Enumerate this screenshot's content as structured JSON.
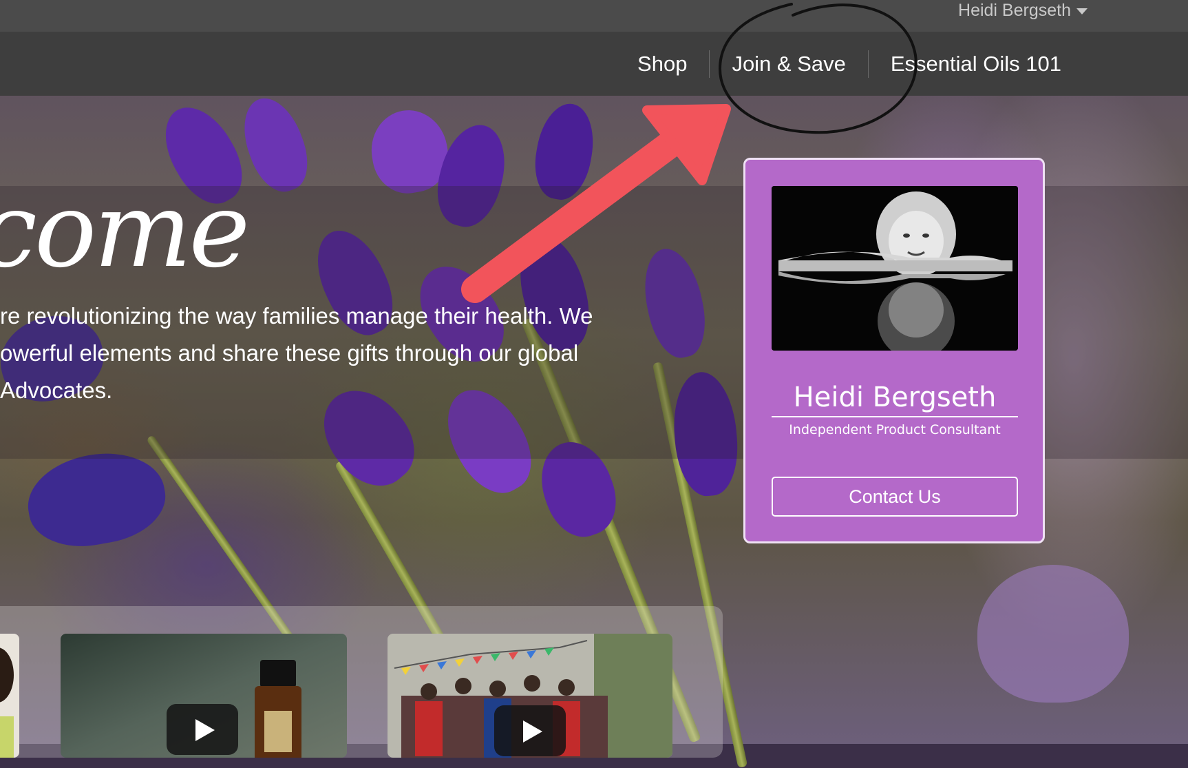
{
  "user_bar": {
    "user_name": "Heidi Bergseth",
    "caret_icon": "caret-down-icon"
  },
  "nav": {
    "items": [
      {
        "label": "Shop"
      },
      {
        "label": "Join & Save"
      },
      {
        "label": "Essential Oils 101"
      }
    ]
  },
  "hero": {
    "welcome_partial": "come",
    "intro_lines": [
      "re revolutionizing the way families manage their health. We",
      "owerful elements and share these gifts through our global",
      "Advocates."
    ]
  },
  "consultant_card": {
    "name": "Heidi Bergseth",
    "title": "Independent Product Consultant",
    "contact_label": "Contact Us",
    "background_color": "#b469c9"
  },
  "videos": {
    "play_icon": "play-icon",
    "count_visible": 3
  },
  "annotation": {
    "arrow_color": "#f2545b",
    "circle_color": "#111111",
    "circled_item": "Join & Save"
  }
}
